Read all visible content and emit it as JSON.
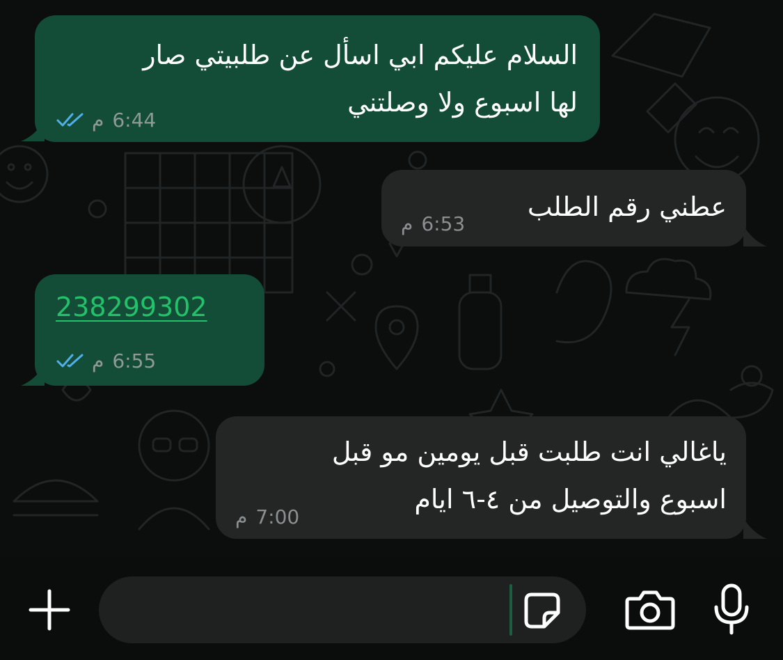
{
  "colors": {
    "outgoing_bubble": "#144d37",
    "incoming_bubble": "#242626",
    "link": "#23c26a",
    "read_ticks": "#4fb0e8",
    "background": "#0c0d0d"
  },
  "messages": [
    {
      "direction": "outgoing",
      "lines": [
        "السلام عليكم ابي اسأل عن طلبيتي صار",
        "لها اسبوع ولا وصلتني"
      ],
      "time": "6:44",
      "meridiem": "م",
      "status": "read"
    },
    {
      "direction": "incoming",
      "lines": [
        "عطني رقم الطلب"
      ],
      "time": "6:53",
      "meridiem": "م"
    },
    {
      "direction": "outgoing",
      "link": "238299302",
      "time": "6:55",
      "meridiem": "م",
      "status": "read"
    },
    {
      "direction": "incoming",
      "lines": [
        "ياغالي انت طلبت قبل يومين مو قبل",
        "اسبوع والتوصيل من ٤-٦ ايام"
      ],
      "time": "7:00",
      "meridiem": "م"
    }
  ],
  "composer": {
    "placeholder": "",
    "value": ""
  },
  "icons": {
    "add": "plus-icon",
    "sticker": "sticker-icon",
    "camera": "camera-icon",
    "mic": "microphone-icon",
    "read_status": "double-check-icon"
  }
}
